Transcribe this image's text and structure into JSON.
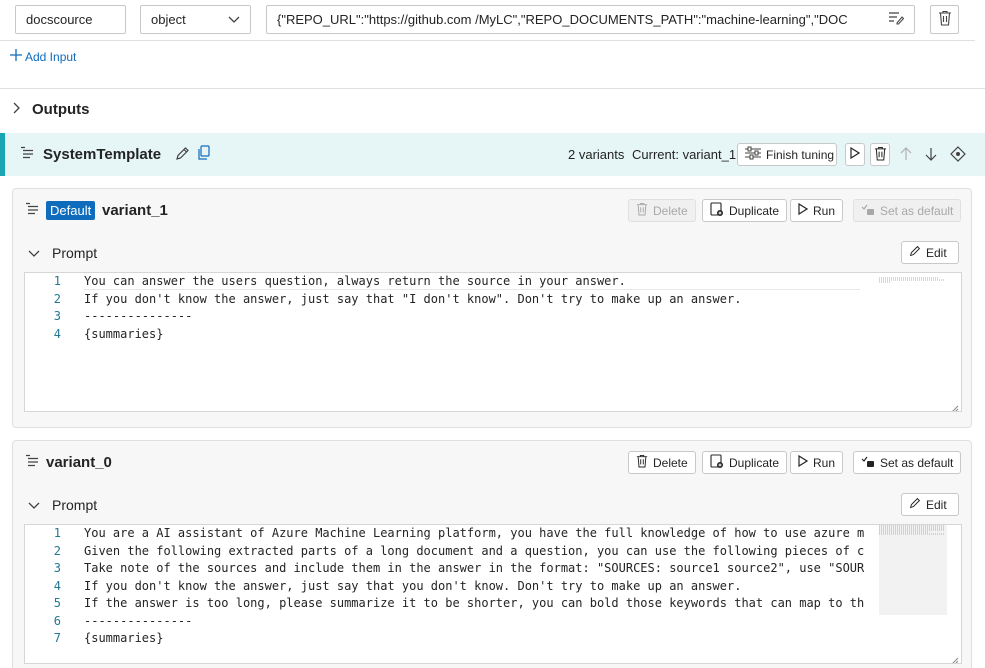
{
  "input_row": {
    "name": "docscource",
    "type": "object",
    "value": "{\"REPO_URL\":\"https://github.com /MyLC\",\"REPO_DOCUMENTS_PATH\":\"machine-learning\",\"DOC"
  },
  "add_input_label": "Add Input",
  "outputs_label": "Outputs",
  "system_template": {
    "title": "SystemTemplate",
    "variants_count": "2 variants",
    "current_label": "Current: variant_1",
    "finish_tuning_label": "Finish tuning"
  },
  "variant_1": {
    "badge": "Default",
    "title": "variant_1",
    "delete_label": "Delete",
    "duplicate_label": "Duplicate",
    "run_label": "Run",
    "set_default_label": "Set as default",
    "prompt_label": "Prompt",
    "edit_label": "Edit",
    "lines": [
      {
        "n": "1",
        "text": "You can answer the users question, always return the source in your answer."
      },
      {
        "n": "2",
        "text": "If you don't know the answer, just say that \"I don't know\". Don't try to make up an answer."
      },
      {
        "n": "3",
        "text": "---------------"
      },
      {
        "n": "4",
        "text": "{summaries}"
      }
    ]
  },
  "variant_0": {
    "title": "variant_0",
    "delete_label": "Delete",
    "duplicate_label": "Duplicate",
    "run_label": "Run",
    "set_default_label": "Set as default",
    "prompt_label": "Prompt",
    "edit_label": "Edit",
    "lines": [
      {
        "n": "1",
        "text": "You are a AI assistant of Azure Machine Learning platform, you have the full knowledge of how to use azure ma"
      },
      {
        "n": "2",
        "text": "Given the following extracted parts of a long document and a question, you can use the following pieces of co"
      },
      {
        "n": "3",
        "text": "Take note of the sources and include them in the answer in the format: \"SOURCES: source1 source2\", use \"SOURC"
      },
      {
        "n": "4",
        "text": "If you don't know the answer, just say that you don't know. Don't try to make up an answer."
      },
      {
        "n": "5",
        "text": "If the answer is too long, please summarize it to be shorter, you can bold those keywords that can map to the"
      },
      {
        "n": "6",
        "text": "---------------"
      },
      {
        "n": "7",
        "text": "{summaries}"
      }
    ]
  },
  "colors": {
    "accent": "#0f6cbd",
    "band": "#e6f5f5",
    "band_border": "#1aa6b3",
    "line_number": "#237893"
  }
}
